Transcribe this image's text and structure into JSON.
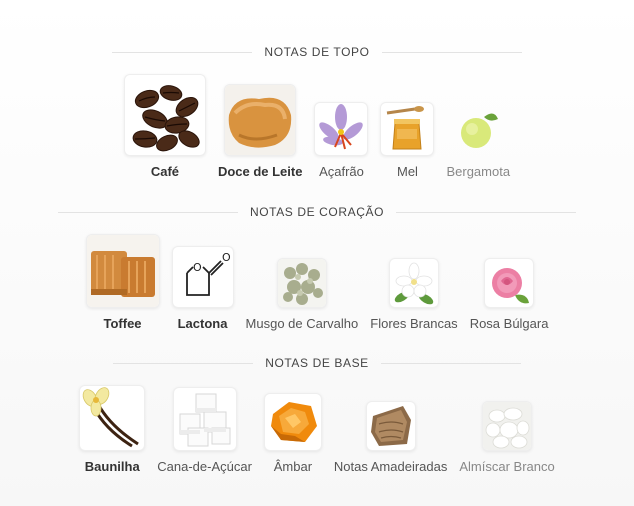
{
  "sections": [
    {
      "title": "NOTAS DE TOPO",
      "notes": [
        {
          "name": "Café",
          "icon": "coffee-beans-icon",
          "emphasis": "strong"
        },
        {
          "name": "Doce de Leite",
          "icon": "dulce-de-leche-icon",
          "emphasis": "strong"
        },
        {
          "name": "Açafrão",
          "icon": "saffron-flower-icon",
          "emphasis": "medium"
        },
        {
          "name": "Mel",
          "icon": "honey-jar-icon",
          "emphasis": "medium"
        },
        {
          "name": "Bergamota",
          "icon": "bergamot-fruit-icon",
          "emphasis": "light"
        }
      ]
    },
    {
      "title": "NOTAS DE CORAÇÃO",
      "notes": [
        {
          "name": "Toffee",
          "icon": "toffee-icon",
          "emphasis": "strong"
        },
        {
          "name": "Lactona",
          "icon": "lactone-molecule-icon",
          "emphasis": "strong"
        },
        {
          "name": "Musgo de Carvalho",
          "icon": "oakmoss-icon",
          "emphasis": "medium"
        },
        {
          "name": "Flores Brancas",
          "icon": "white-flowers-icon",
          "emphasis": "medium"
        },
        {
          "name": "Rosa Búlgara",
          "icon": "pink-rose-icon",
          "emphasis": "medium"
        }
      ]
    },
    {
      "title": "NOTAS DE BASE",
      "notes": [
        {
          "name": "Baunilha",
          "icon": "vanilla-icon",
          "emphasis": "strong"
        },
        {
          "name": "Cana-de-Açúcar",
          "icon": "sugar-cubes-icon",
          "emphasis": "medium"
        },
        {
          "name": "Âmbar",
          "icon": "amber-stone-icon",
          "emphasis": "medium"
        },
        {
          "name": "Notas Amadeiradas",
          "icon": "wood-icon",
          "emphasis": "medium"
        },
        {
          "name": "Almíscar Branco",
          "icon": "white-musk-icon",
          "emphasis": "light"
        }
      ]
    }
  ]
}
